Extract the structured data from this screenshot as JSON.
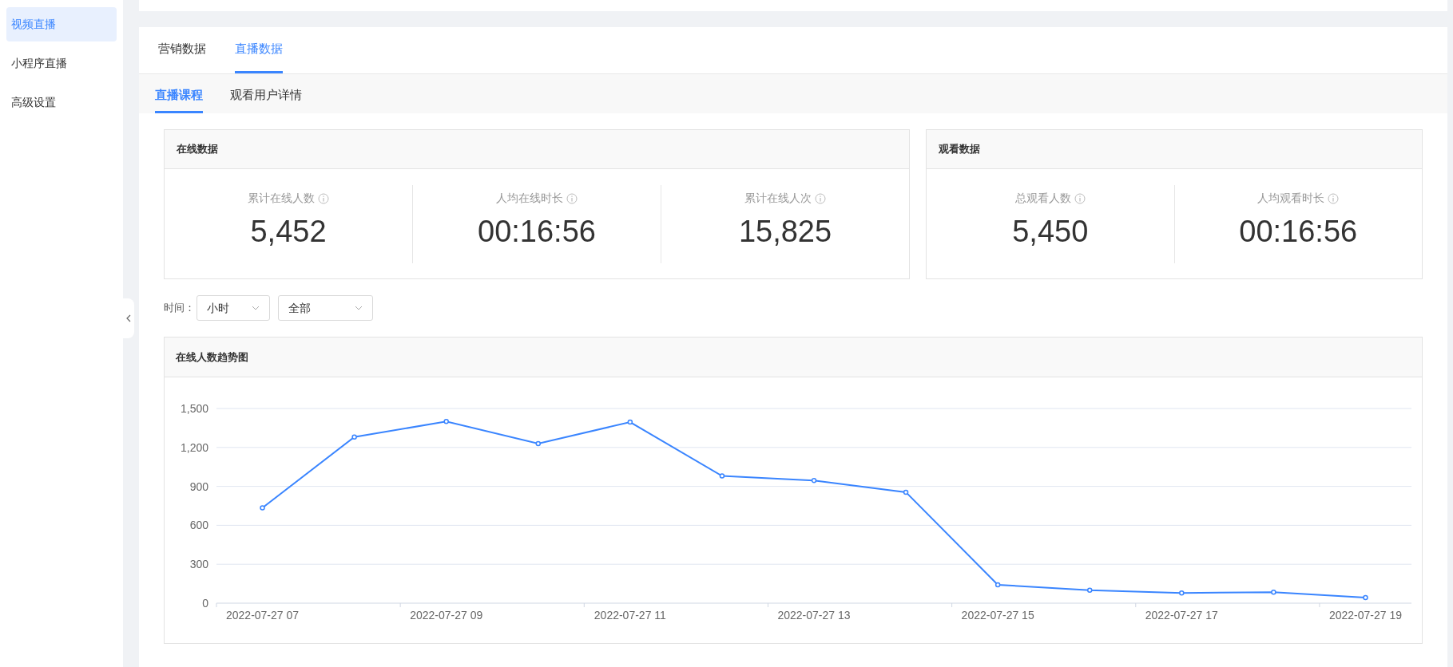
{
  "sidebar": {
    "items": [
      {
        "label": "视频直播",
        "selected": true
      },
      {
        "label": "小程序直播",
        "selected": false
      },
      {
        "label": "高级设置",
        "selected": false
      }
    ]
  },
  "tabs": [
    {
      "label": "营销数据",
      "selected": false
    },
    {
      "label": "直播数据",
      "selected": true
    }
  ],
  "subtabs": [
    {
      "label": "直播课程",
      "selected": true
    },
    {
      "label": "观看用户详情",
      "selected": false
    }
  ],
  "panels": [
    {
      "title": "在线数据",
      "stats": [
        {
          "label": "累计在线人数",
          "value": "5,452"
        },
        {
          "label": "人均在线时长",
          "value": "00:16:56"
        },
        {
          "label": "累计在线人次",
          "value": "15,825"
        }
      ]
    },
    {
      "title": "观看数据",
      "stats": [
        {
          "label": "总观看人数",
          "value": "5,450"
        },
        {
          "label": "人均观看时长",
          "value": "00:16:56"
        }
      ]
    }
  ],
  "filters": {
    "label": "时间：",
    "selects": [
      {
        "value": "小时"
      },
      {
        "value": "全部"
      }
    ]
  },
  "trend": {
    "title": "在线人数趋势图",
    "chart_data": {
      "type": "line",
      "categories": [
        "2022-07-27 07",
        null,
        "2022-07-27 09",
        null,
        "2022-07-27 11",
        null,
        "2022-07-27 13",
        null,
        "2022-07-27 15",
        null,
        "2022-07-27 17",
        null,
        "2022-07-27 19"
      ],
      "grid": true,
      "series": [
        {
          "color": "#3a85ff",
          "marker": "circle",
          "values": [
            735,
            1280,
            1400,
            1230,
            1395,
            980,
            945,
            855,
            142,
            100,
            78,
            85,
            43
          ]
        }
      ],
      "ylim": [
        0,
        1500
      ],
      "yticks": [
        {
          "value": 0,
          "label": "0"
        },
        {
          "value": 300,
          "label": "300"
        },
        {
          "value": 600,
          "label": "600"
        },
        {
          "value": 900,
          "label": "900"
        },
        {
          "value": 1200,
          "label": "1,200"
        },
        {
          "value": 1500,
          "label": "1,500"
        }
      ]
    }
  }
}
